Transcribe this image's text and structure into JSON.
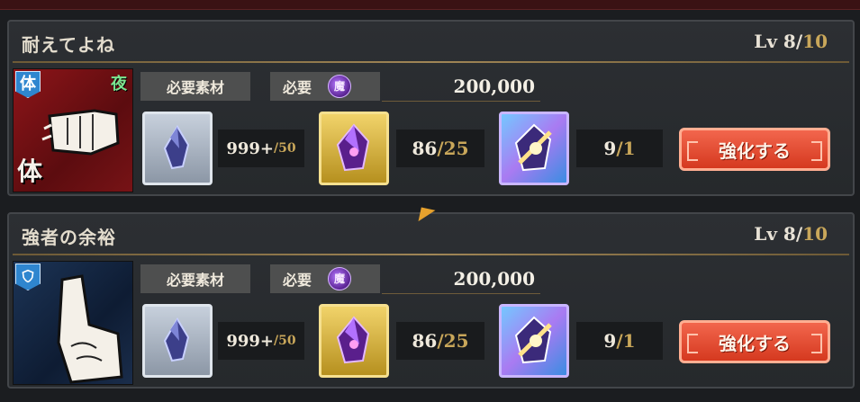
{
  "skills": [
    {
      "title": "耐えてよね",
      "lv_prefix": "Lv 8/",
      "lv_max": "10",
      "badge": "体",
      "night": "夜",
      "portrait_char": "体",
      "materials_label": "必要素材",
      "need_label": "必要",
      "currency_glyph": "魔",
      "cost": "200,000",
      "mat1_have": "999+",
      "mat1_need": "/50",
      "mat2_have": "86",
      "mat2_need": "/25",
      "mat3_have": "9",
      "mat3_need": "/1",
      "button": "強化する"
    },
    {
      "title": "強者の余裕",
      "lv_prefix": "Lv 8/",
      "lv_max": "10",
      "materials_label": "必要素材",
      "need_label": "必要",
      "currency_glyph": "魔",
      "cost": "200,000",
      "mat1_have": "999+",
      "mat1_need": "/50",
      "mat2_have": "86",
      "mat2_need": "/25",
      "mat3_have": "9",
      "mat3_need": "/1",
      "button": "強化する"
    }
  ],
  "colors": {
    "background": "#1b1d20",
    "accent_gold": "#c9a75a",
    "button_red": "#e24a2e",
    "badge_blue": "#2f86cf",
    "night_green": "#7be48f"
  },
  "icons": {
    "portrait1": "fist-portrait",
    "portrait2": "hand-portrait",
    "shield": "shield-icon",
    "currency": "magic-coin-icon",
    "mat1": "gray-crystal-icon",
    "mat2": "purple-crystal-icon",
    "mat3": "rainbow-crystal-icon"
  }
}
